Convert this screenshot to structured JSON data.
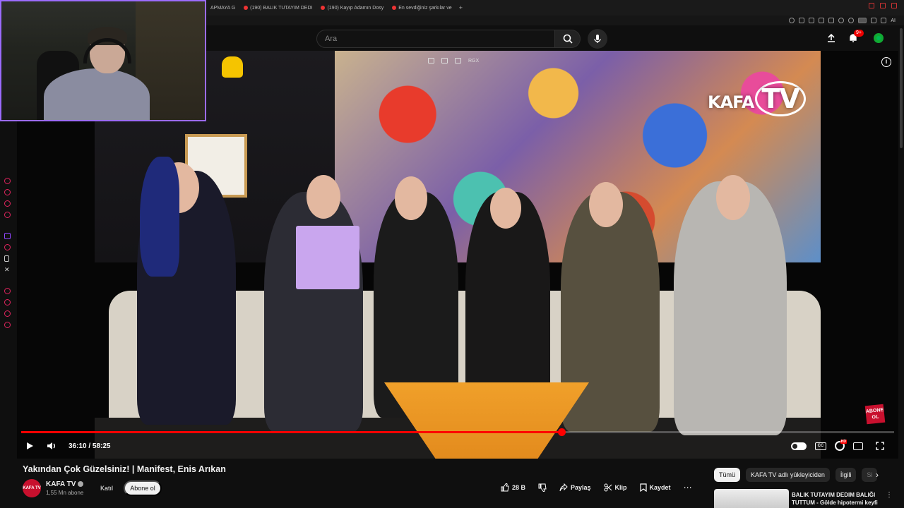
{
  "browser": {
    "tabs": [
      {
        "label": "APMAYA G"
      },
      {
        "label": "(190) BALIK TUTAYIM DEDI"
      },
      {
        "label": "(190) Kayıp Adamın Dosy"
      },
      {
        "label": "En sevdiğiniz şarkılar ve"
      }
    ],
    "add_tab": "+",
    "ai_label": "AI"
  },
  "header": {
    "search_placeholder": "Ara",
    "notification_count": "9+"
  },
  "video": {
    "channel_watermark_1": "KAFA",
    "channel_watermark_2": "TV",
    "overlay_label": "RGX",
    "stamp_text": "ABONE OL",
    "current_time": "36:10",
    "duration": "58:25",
    "time_display": "36:10 / 58:25",
    "progress": 0.619,
    "brand_color": "#ff0000"
  },
  "meta": {
    "title": "Yakından Çok Güzelsiniz! | Manifest, Enis Arıkan",
    "channel_name": "KAFA TV",
    "subscribers": "1,55 Mn abone",
    "avatar_text": "KAFA TV",
    "join_label": "Katıl",
    "subscribe_label": "Abone ol",
    "likes": "28 B",
    "share_label": "Paylaş",
    "clip_label": "Klip",
    "save_label": "Kaydet"
  },
  "recommendations": {
    "chips": [
      {
        "label": "Tümü",
        "active": true
      },
      {
        "label": "KAFA TV adlı yükleyiciden",
        "active": false
      },
      {
        "label": "İlgili",
        "active": false
      },
      {
        "label": "Si",
        "active": false
      }
    ],
    "first_title": "BALIK TUTAYIM DEDIM BALIĞI TUTTUM - Gölde hipotermi keyfi"
  }
}
